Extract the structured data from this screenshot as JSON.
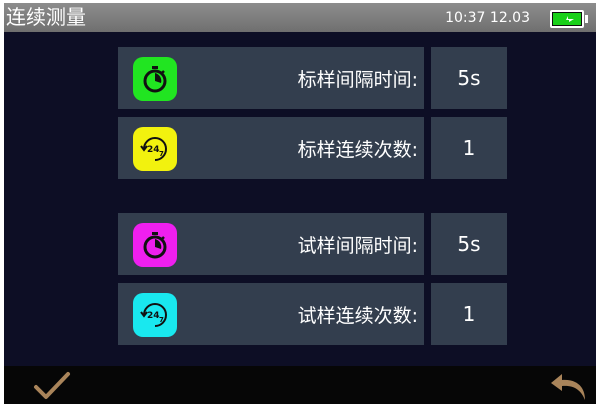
{
  "header": {
    "title": "连续测量",
    "time": "10:37",
    "date": "12.03",
    "battery_icon": "battery-charging-icon",
    "battery_color": "#19d019"
  },
  "settings": {
    "standard": {
      "interval": {
        "label": "标样间隔时间:",
        "value": "5s",
        "icon": "stopwatch-icon",
        "icon_color": "#21e521"
      },
      "count": {
        "label": "标样连续次数:",
        "value": "1",
        "icon": "24-7-cycle-icon",
        "icon_color": "#f2f20e"
      }
    },
    "sample": {
      "interval": {
        "label": "试样间隔时间:",
        "value": "5s",
        "icon": "stopwatch-icon",
        "icon_color": "#ef1fef"
      },
      "count": {
        "label": "试样连续次数:",
        "value": "1",
        "icon": "24-7-cycle-icon",
        "icon_color": "#19e8ef"
      }
    }
  },
  "footer": {
    "confirm_icon": "checkmark-icon",
    "back_icon": "return-arrow-icon",
    "icon_color": "#a9845a"
  }
}
